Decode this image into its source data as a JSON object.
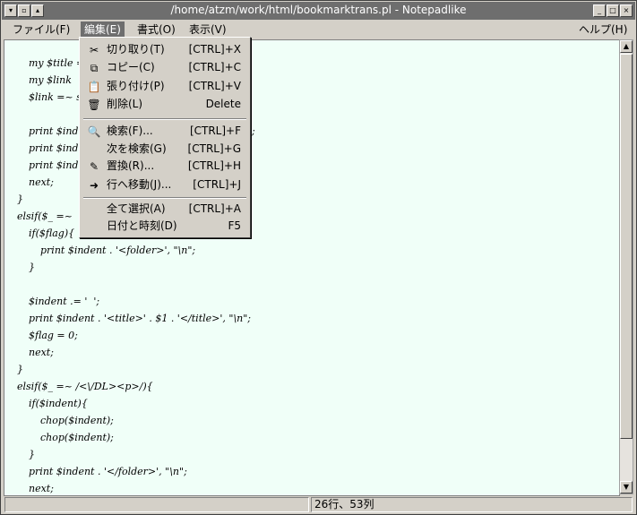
{
  "window": {
    "title": "/home/atzm/work/html/bookmarktrans.pl - Notepadlike"
  },
  "menubar": {
    "file": "ファイル(F)",
    "edit": "編集(E)",
    "format": "書式(O)",
    "view": "表示(V)",
    "help": "ヘルプ(H)"
  },
  "edit_menu": {
    "cut": {
      "label": "切り取り(T)",
      "shortcut": "[CTRL]+X",
      "icon": "scissors-icon"
    },
    "copy": {
      "label": "コピー(C)",
      "shortcut": "[CTRL]+C",
      "icon": "copy-icon"
    },
    "paste": {
      "label": "張り付け(P)",
      "shortcut": "[CTRL]+V",
      "icon": "paste-icon"
    },
    "delete": {
      "label": "削除(L)",
      "shortcut": "Delete",
      "icon": "trash-icon"
    },
    "find": {
      "label": "検索(F)...",
      "shortcut": "[CTRL]+F",
      "icon": "magnifier-icon"
    },
    "find_next": {
      "label": "次を検索(G)",
      "shortcut": "[CTRL]+G"
    },
    "replace": {
      "label": "置換(R)...",
      "shortcut": "[CTRL]+H",
      "icon": "replace-icon"
    },
    "goto": {
      "label": "行へ移動(J)...",
      "shortcut": "[CTRL]+J",
      "icon": "goto-icon"
    },
    "select_all": {
      "label": "全て選択(A)",
      "shortcut": "[CTRL]+A"
    },
    "datetime": {
      "label": "日付と時刻(D)",
      "shortcut": "F5"
    }
  },
  "editor": {
    "lines": [
      "my $title =",
      "my $link  =",
      "$link =~ s",
      "",
      "print $inde",
      "print $inde",
      "print $inde",
      "next;",
      "}",
      "elsif($_ =~",
      "if($flag){",
      "print $indent . '<folder>', \"\\n\";",
      "}",
      "",
      "$indent .= '  ';",
      "print $indent . '<title>' . $1 . '</title>', \"\\n\";",
      "$flag = 0;",
      "next;",
      "}",
      "elsif($_ =~ /<\\/DL><p>/){",
      "if($indent){",
      "chop($indent);",
      "chop($indent);",
      "}",
      "print $indent . '</folder>', \"\\n\";",
      "next;"
    ],
    "partial_right": [
      ";"
    ]
  },
  "status": {
    "position": "26行、53列"
  }
}
